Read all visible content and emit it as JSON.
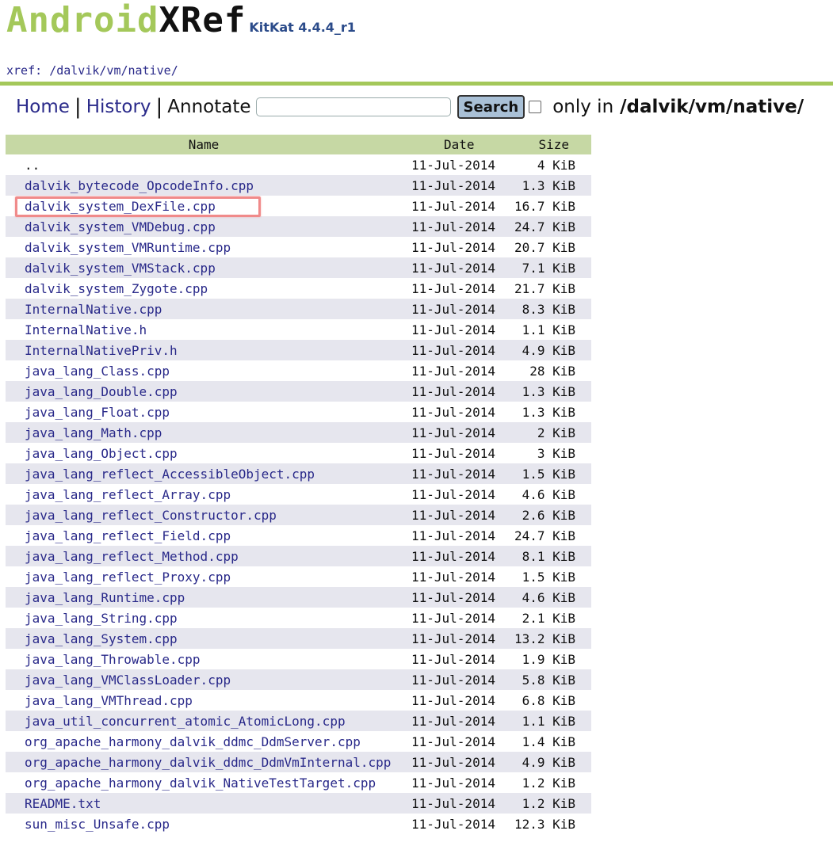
{
  "logo": {
    "brand_a": "Android",
    "brand_b": "XRef",
    "version": "KitKat 4.4.4_r1"
  },
  "breadcrumb": {
    "prefix": "xref: ",
    "path": "/dalvik/vm/native/"
  },
  "colors": {
    "accent_green": "#a4c85a",
    "header_bg": "#c6d8a4",
    "alt_row_bg": "#e6e6ee",
    "link": "#2a2a8a",
    "highlight": "#f08a8a"
  },
  "nav": {
    "home": "Home",
    "history": "History",
    "annotate": "Annotate",
    "separator": "|",
    "search_value": "",
    "search_button": "Search",
    "only_in_label": "only in",
    "only_in_path": "/dalvik/vm/native/"
  },
  "table": {
    "headers": {
      "name": "Name",
      "date": "Date",
      "size": "Size"
    },
    "rows": [
      {
        "name": "..",
        "date": "11-Jul-2014",
        "size": "4 KiB",
        "link": false
      },
      {
        "name": "dalvik_bytecode_OpcodeInfo.cpp",
        "date": "11-Jul-2014",
        "size": "1.3 KiB",
        "link": true
      },
      {
        "name": "dalvik_system_DexFile.cpp",
        "date": "11-Jul-2014",
        "size": "16.7 KiB",
        "link": true
      },
      {
        "name": "dalvik_system_VMDebug.cpp",
        "date": "11-Jul-2014",
        "size": "24.7 KiB",
        "link": true
      },
      {
        "name": "dalvik_system_VMRuntime.cpp",
        "date": "11-Jul-2014",
        "size": "20.7 KiB",
        "link": true
      },
      {
        "name": "dalvik_system_VMStack.cpp",
        "date": "11-Jul-2014",
        "size": "7.1 KiB",
        "link": true
      },
      {
        "name": "dalvik_system_Zygote.cpp",
        "date": "11-Jul-2014",
        "size": "21.7 KiB",
        "link": true
      },
      {
        "name": "InternalNative.cpp",
        "date": "11-Jul-2014",
        "size": "8.3 KiB",
        "link": true
      },
      {
        "name": "InternalNative.h",
        "date": "11-Jul-2014",
        "size": "1.1 KiB",
        "link": true
      },
      {
        "name": "InternalNativePriv.h",
        "date": "11-Jul-2014",
        "size": "4.9 KiB",
        "link": true
      },
      {
        "name": "java_lang_Class.cpp",
        "date": "11-Jul-2014",
        "size": "28 KiB",
        "link": true
      },
      {
        "name": "java_lang_Double.cpp",
        "date": "11-Jul-2014",
        "size": "1.3 KiB",
        "link": true
      },
      {
        "name": "java_lang_Float.cpp",
        "date": "11-Jul-2014",
        "size": "1.3 KiB",
        "link": true
      },
      {
        "name": "java_lang_Math.cpp",
        "date": "11-Jul-2014",
        "size": "2 KiB",
        "link": true
      },
      {
        "name": "java_lang_Object.cpp",
        "date": "11-Jul-2014",
        "size": "3 KiB",
        "link": true
      },
      {
        "name": "java_lang_reflect_AccessibleObject.cpp",
        "date": "11-Jul-2014",
        "size": "1.5 KiB",
        "link": true
      },
      {
        "name": "java_lang_reflect_Array.cpp",
        "date": "11-Jul-2014",
        "size": "4.6 KiB",
        "link": true
      },
      {
        "name": "java_lang_reflect_Constructor.cpp",
        "date": "11-Jul-2014",
        "size": "2.6 KiB",
        "link": true
      },
      {
        "name": "java_lang_reflect_Field.cpp",
        "date": "11-Jul-2014",
        "size": "24.7 KiB",
        "link": true
      },
      {
        "name": "java_lang_reflect_Method.cpp",
        "date": "11-Jul-2014",
        "size": "8.1 KiB",
        "link": true
      },
      {
        "name": "java_lang_reflect_Proxy.cpp",
        "date": "11-Jul-2014",
        "size": "1.5 KiB",
        "link": true
      },
      {
        "name": "java_lang_Runtime.cpp",
        "date": "11-Jul-2014",
        "size": "4.6 KiB",
        "link": true
      },
      {
        "name": "java_lang_String.cpp",
        "date": "11-Jul-2014",
        "size": "2.1 KiB",
        "link": true
      },
      {
        "name": "java_lang_System.cpp",
        "date": "11-Jul-2014",
        "size": "13.2 KiB",
        "link": true
      },
      {
        "name": "java_lang_Throwable.cpp",
        "date": "11-Jul-2014",
        "size": "1.9 KiB",
        "link": true
      },
      {
        "name": "java_lang_VMClassLoader.cpp",
        "date": "11-Jul-2014",
        "size": "5.8 KiB",
        "link": true
      },
      {
        "name": "java_lang_VMThread.cpp",
        "date": "11-Jul-2014",
        "size": "6.8 KiB",
        "link": true
      },
      {
        "name": "java_util_concurrent_atomic_AtomicLong.cpp",
        "date": "11-Jul-2014",
        "size": "1.1 KiB",
        "link": true
      },
      {
        "name": "org_apache_harmony_dalvik_ddmc_DdmServer.cpp",
        "date": "11-Jul-2014",
        "size": "1.4 KiB",
        "link": true
      },
      {
        "name": "org_apache_harmony_dalvik_ddmc_DdmVmInternal.cpp",
        "date": "11-Jul-2014",
        "size": "4.9 KiB",
        "link": true
      },
      {
        "name": "org_apache_harmony_dalvik_NativeTestTarget.cpp",
        "date": "11-Jul-2014",
        "size": "1.2 KiB",
        "link": true
      },
      {
        "name": "README.txt",
        "date": "11-Jul-2014",
        "size": "1.2 KiB",
        "link": true
      },
      {
        "name": "sun_misc_Unsafe.cpp",
        "date": "11-Jul-2014",
        "size": "12.3 KiB",
        "link": true
      }
    ]
  }
}
